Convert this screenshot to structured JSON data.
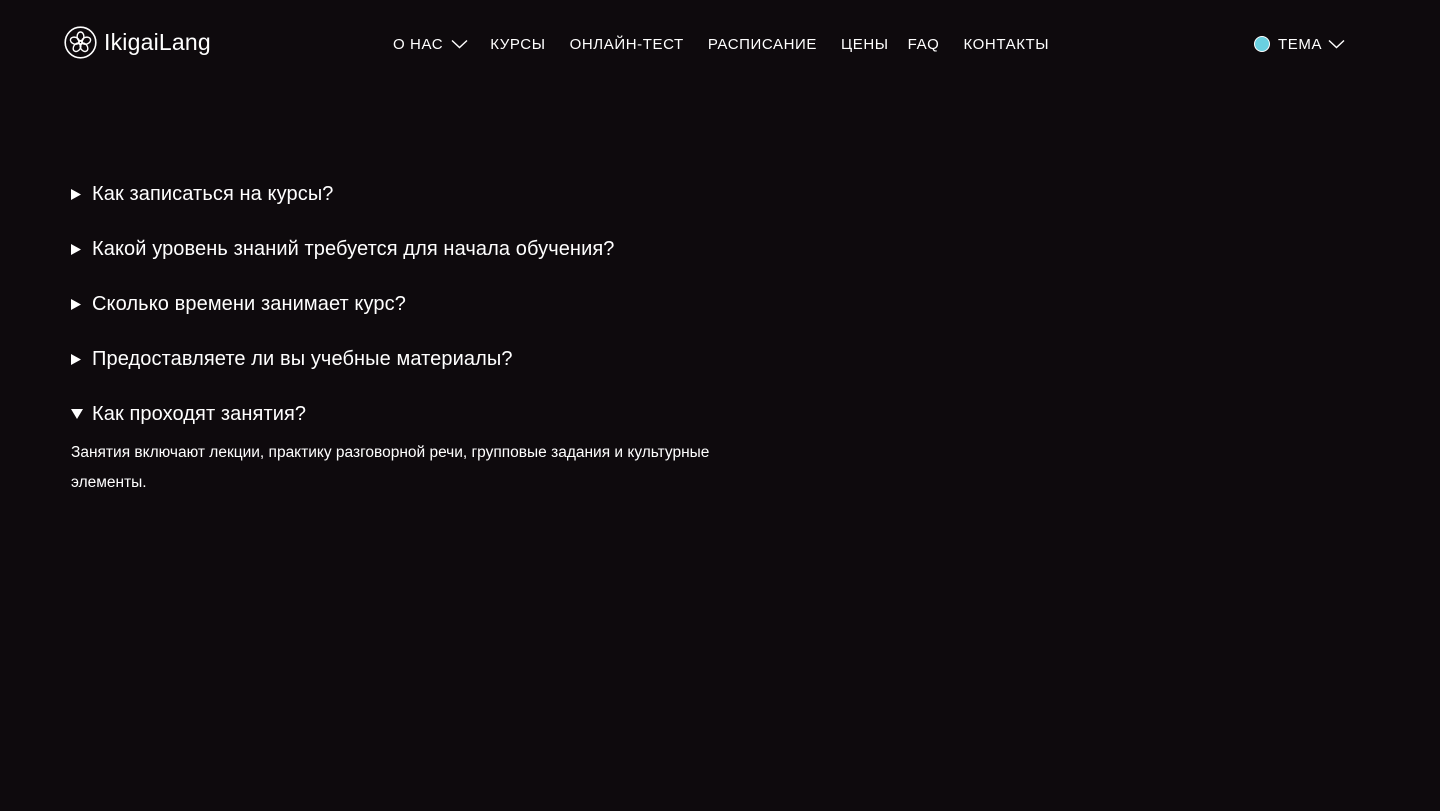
{
  "brand": {
    "name": "IkigaiLang",
    "logo_icon": "flower-icon"
  },
  "nav": {
    "about": "О НАС",
    "courses": "КУРСЫ",
    "online_test": "ОНЛАЙН-ТЕСТ",
    "schedule": "РАСПИСАНИЕ",
    "prices": "ЦЕНЫ",
    "faq": "FAQ",
    "contacts": "КОНТАКТЫ"
  },
  "theme": {
    "label": "ТЕМА",
    "dot_color": "#6ad0e0"
  },
  "faq": {
    "items": [
      {
        "question": "Как записаться на курсы?",
        "open": false
      },
      {
        "question": "Какой уровень знаний требуется для начала обучения?",
        "open": false
      },
      {
        "question": "Сколько времени занимает курс?",
        "open": false
      },
      {
        "question": "Предоставляете ли вы учебные материалы?",
        "open": false
      },
      {
        "question": "Как проходят занятия?",
        "open": true,
        "answer": "Занятия включают лекции, практику разговорной речи, групповые задания и культурные элементы."
      }
    ]
  },
  "colors": {
    "background": "#0e0a0d",
    "text": "#ffffff"
  }
}
